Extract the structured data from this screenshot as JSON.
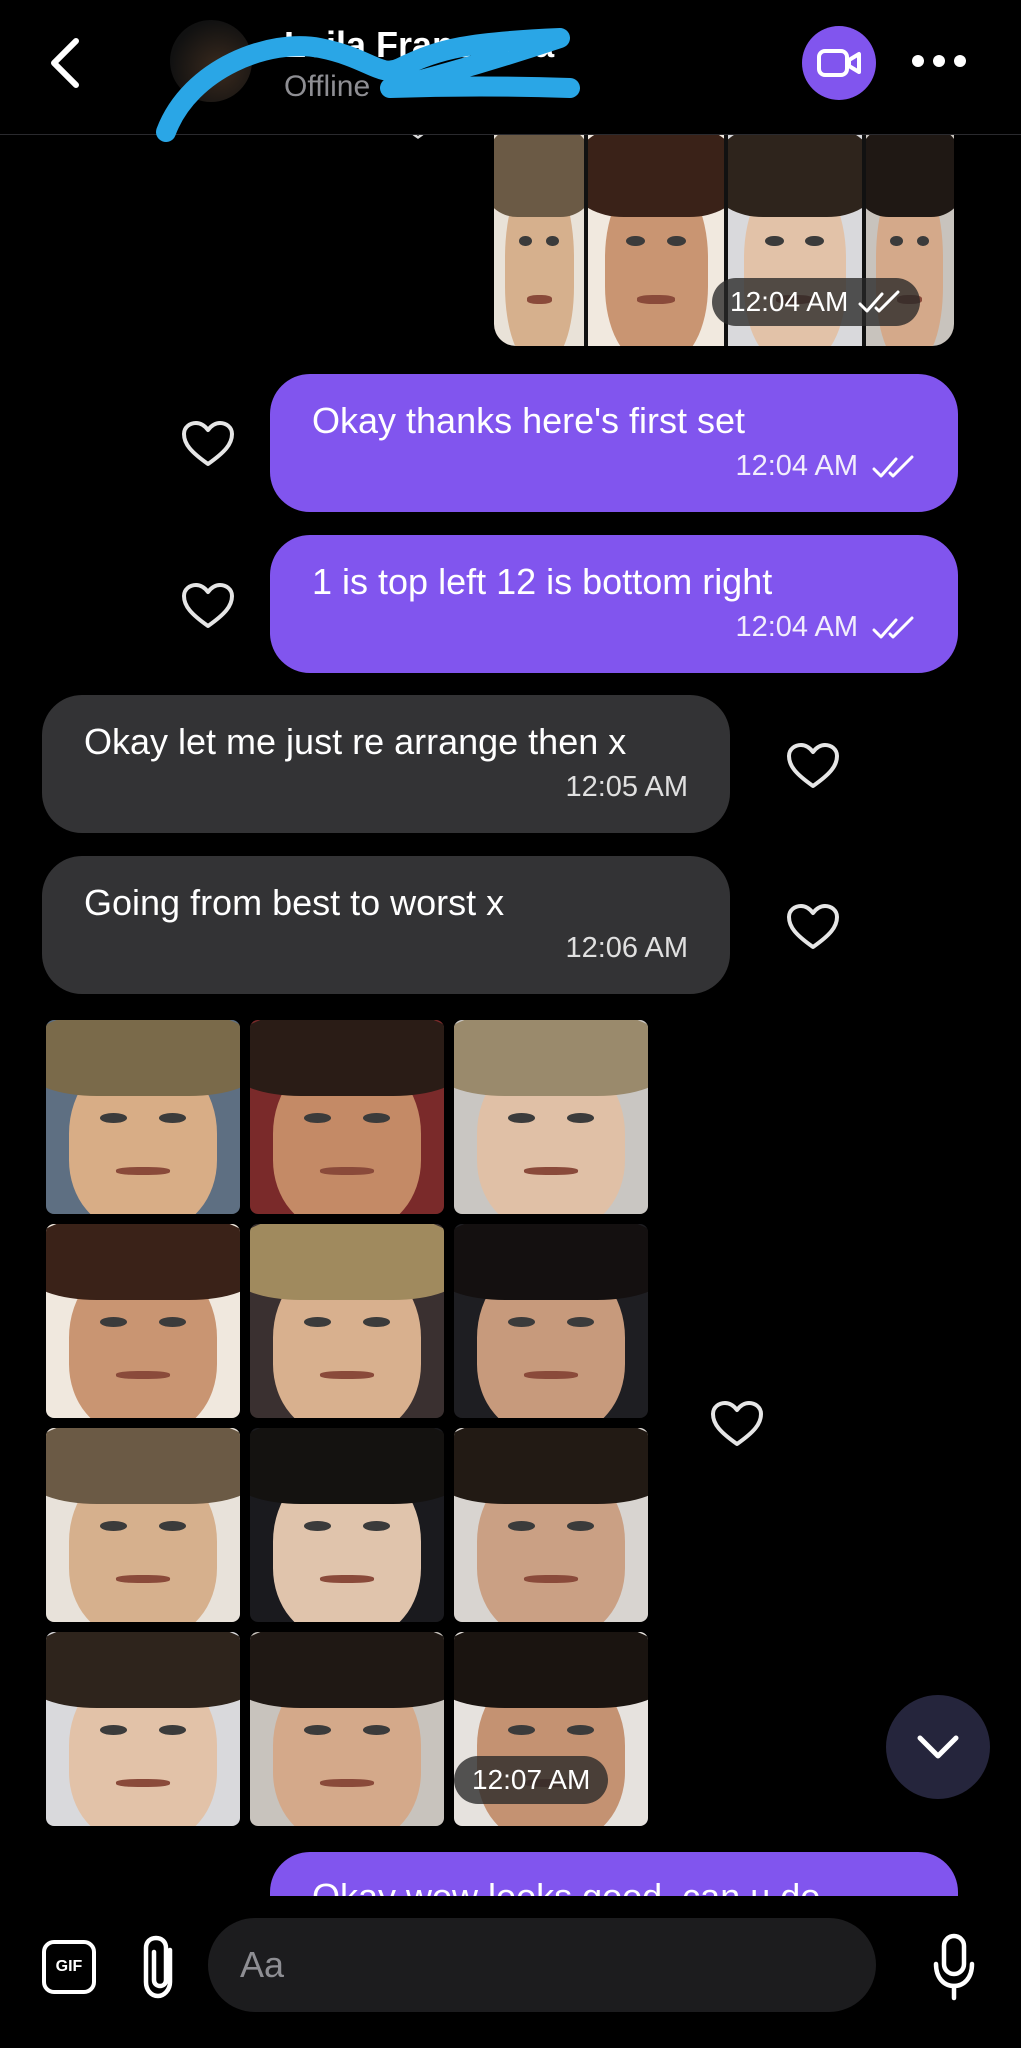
{
  "header": {
    "contact_name": "Leila Francesca",
    "status": "Offline"
  },
  "messages": [
    {
      "type": "image-set",
      "direction": "out",
      "time": "12:04 AM",
      "read": true
    },
    {
      "type": "text",
      "direction": "out",
      "text": "Okay thanks here's first set",
      "time": "12:04 AM",
      "read": true
    },
    {
      "type": "text",
      "direction": "out",
      "text": "1 is top left 12 is bottom right",
      "time": "12:04 AM",
      "read": true
    },
    {
      "type": "text",
      "direction": "in",
      "text": "Okay let me just re arrange then x",
      "time": "12:05 AM"
    },
    {
      "type": "text",
      "direction": "in",
      "text": "Going from best to worst x",
      "time": "12:06 AM"
    },
    {
      "type": "image-grid",
      "direction": "in",
      "rows": 4,
      "cols": 3,
      "time": "12:07 AM"
    },
    {
      "type": "text",
      "direction": "out",
      "text": "Okay wow looks good, can u do",
      "partial": true
    }
  ],
  "composer": {
    "gif_label": "GIF",
    "placeholder": "Aa"
  },
  "colors": {
    "accent": "#8155ee",
    "incoming_bubble": "#333335",
    "background": "#000000",
    "scroll_button": "#25253c",
    "redaction": "#2aa6e6"
  },
  "icons": {
    "back": "chevron-left-icon",
    "video": "video-camera-icon",
    "more": "more-horizontal-icon",
    "heart": "heart-outline-icon",
    "read": "double-check-icon",
    "scroll": "chevron-down-icon",
    "gif": "gif-icon",
    "attach": "paperclip-icon",
    "mic": "microphone-icon"
  }
}
